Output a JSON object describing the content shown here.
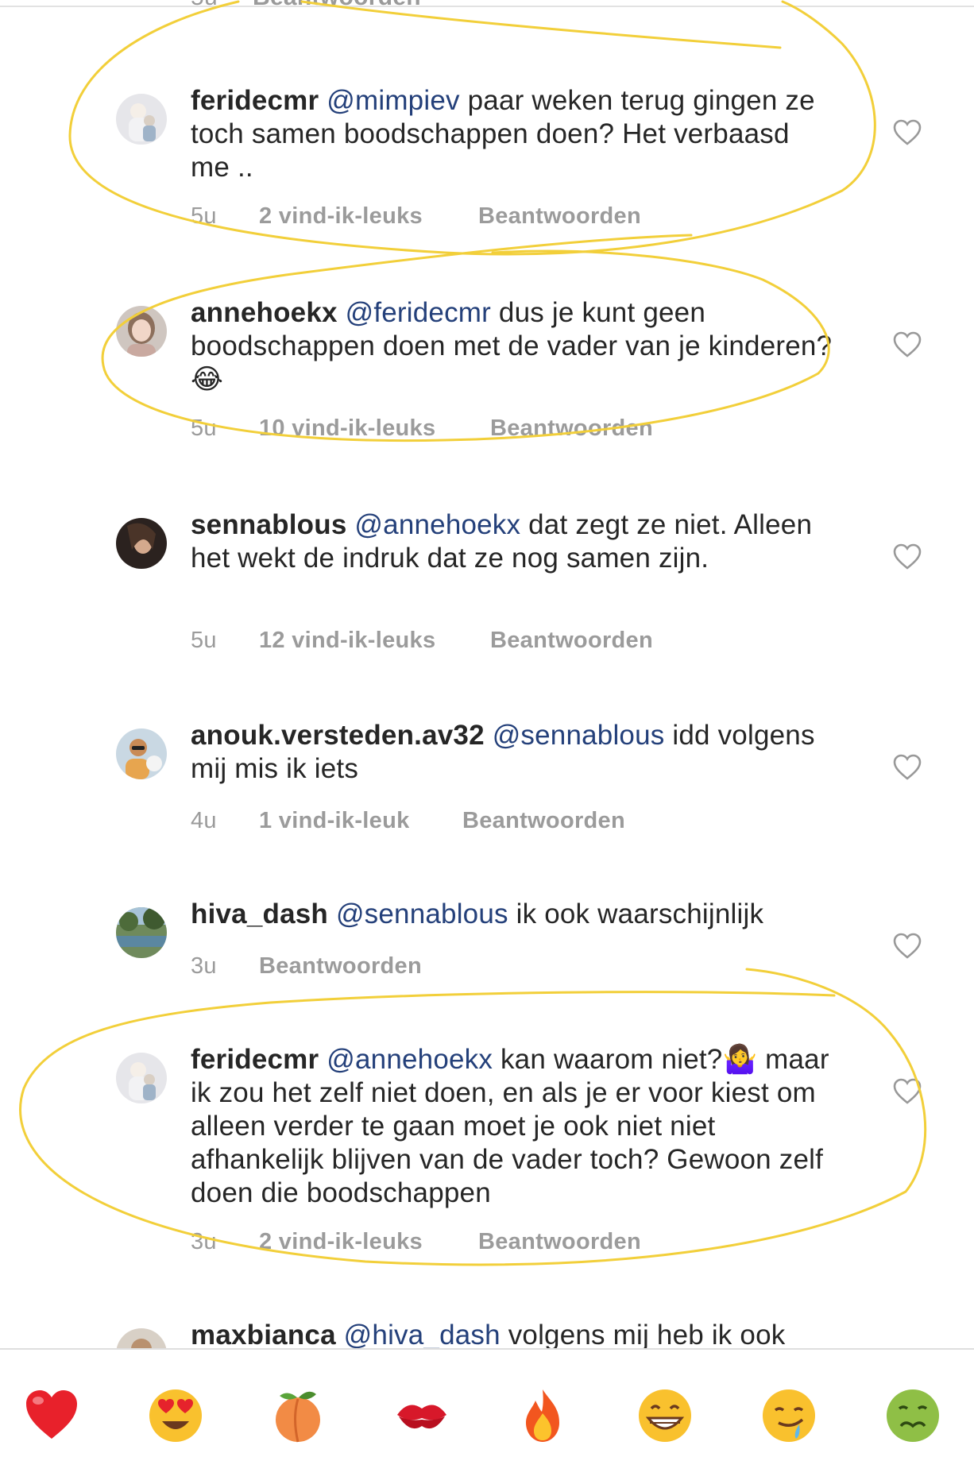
{
  "partial_top": {
    "time": "5u",
    "reply": "Beantwoorden"
  },
  "comments": [
    {
      "username": "feridecmr",
      "mention": "@mimpiev",
      "text": " paar weken terug gingen ze toch samen boodschappen doen? Het verbaasd me ..",
      "time": "5u",
      "likes": "2 vind-ik-leuks",
      "reply": "Beantwoorden",
      "avatar_icon": "avatar-feridecmr"
    },
    {
      "username": "annehoekx",
      "mention": "@feridecmr",
      "text": " dus je kunt geen boodschappen doen met de vader van je kinderen?",
      "emoji": "😂",
      "time": "5u",
      "likes": "10 vind-ik-leuks",
      "reply": "Beantwoorden",
      "avatar_icon": "avatar-annehoekx"
    },
    {
      "username": "sennablous",
      "mention": "@annehoekx",
      "text": " dat zegt ze niet. Alleen het wekt de indruk dat ze nog samen zijn.",
      "time": "5u",
      "likes": "12 vind-ik-leuks",
      "reply": "Beantwoorden",
      "avatar_icon": "avatar-sennablous"
    },
    {
      "username": "anouk.versteden.av32",
      "mention": "@sennablous",
      "text": " idd volgens mij mis ik iets",
      "time": "4u",
      "likes": "1 vind-ik-leuk",
      "reply": "Beantwoorden",
      "avatar_icon": "avatar-anouk"
    },
    {
      "username": "hiva_dash",
      "mention": "@sennablous",
      "text": " ik ook waarschijnlijk",
      "time": "3u",
      "likes": "",
      "reply": "Beantwoorden",
      "avatar_icon": "avatar-hiva"
    },
    {
      "username": "feridecmr",
      "mention": "@annehoekx",
      "text": " kan waarom niet?",
      "emoji": "🤷‍♀️",
      "text2": " maar ik zou het zelf niet doen, en als je er voor kiest om alleen verder te gaan moet je ook niet niet afhankelijk blijven van de vader toch? Gewoon zelf doen die boodschappen",
      "time": "3u",
      "likes": "2 vind-ik-leuks",
      "reply": "Beantwoorden",
      "avatar_icon": "avatar-feridecmr"
    },
    {
      "username": "maxbianca",
      "mention": "@hiva_dash",
      "text": " volgens mij heb ik ook",
      "avatar_icon": "avatar-maxbianca"
    }
  ],
  "emoji_bar": [
    {
      "emoji": "❤️",
      "icon": "red-heart-icon"
    },
    {
      "emoji": "😍",
      "icon": "heart-eyes-icon"
    },
    {
      "emoji": "🍑",
      "icon": "peach-icon"
    },
    {
      "emoji": "💋",
      "icon": "kiss-mark-icon"
    },
    {
      "emoji": "🔥",
      "icon": "fire-icon"
    },
    {
      "emoji": "😁",
      "icon": "grin-icon"
    },
    {
      "emoji": "🤤",
      "icon": "drooling-icon"
    },
    {
      "emoji": "🤢",
      "icon": "nauseated-icon"
    }
  ],
  "colors": {
    "text": "#262626",
    "mention": "#24407a",
    "meta": "#9b9b9b",
    "annotation": "#f2cf3a"
  }
}
